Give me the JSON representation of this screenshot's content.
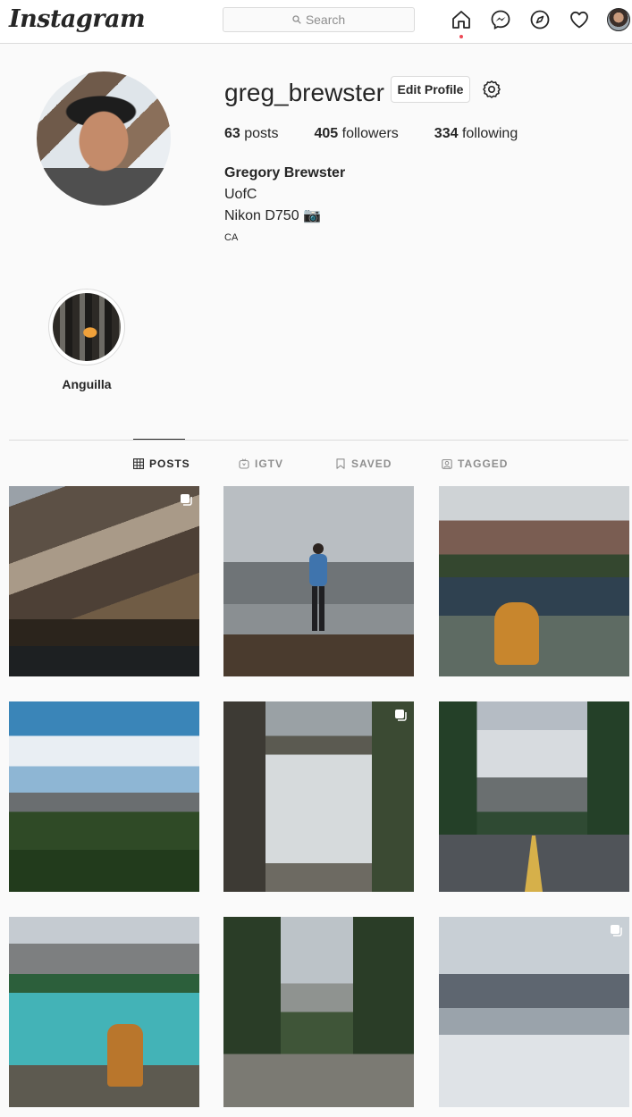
{
  "app": {
    "logo_text": "Instagram"
  },
  "search": {
    "placeholder": "Search"
  },
  "nav": {
    "icons": [
      "home-icon",
      "messenger-icon",
      "explore-icon",
      "activity-heart-icon",
      "profile-avatar"
    ]
  },
  "profile": {
    "username": "greg_brewster",
    "edit_label": "Edit Profile",
    "stats": {
      "posts_count": "63",
      "posts_label": "posts",
      "followers_count": "405",
      "followers_label": "followers",
      "following_count": "334",
      "following_label": "following"
    },
    "bio": {
      "full_name": "Gregory Brewster",
      "line1": "UofC",
      "line2": "Nikon D750 📷",
      "line3": "CA"
    }
  },
  "highlights": [
    {
      "label": "Anguilla"
    }
  ],
  "tabs": [
    {
      "label": "POSTS",
      "icon": "grid-icon",
      "active": true
    },
    {
      "label": "IGTV",
      "icon": "igtv-icon",
      "active": false
    },
    {
      "label": "SAVED",
      "icon": "bookmark-icon",
      "active": false
    },
    {
      "label": "TAGGED",
      "icon": "tagged-icon",
      "active": false
    }
  ],
  "posts": [
    {
      "subject": "mountain forest lake",
      "multi": true
    },
    {
      "subject": "hiker on ridge",
      "multi": false
    },
    {
      "subject": "boots by lake",
      "multi": false
    },
    {
      "subject": "green valley sky",
      "multi": false
    },
    {
      "subject": "waterfall",
      "multi": true
    },
    {
      "subject": "cyclist on road",
      "multi": false
    },
    {
      "subject": "turquoise lake",
      "multi": false
    },
    {
      "subject": "forest creek",
      "multi": false
    },
    {
      "subject": "snowy mountain",
      "multi": true
    }
  ],
  "colors": {
    "text": "#262626",
    "muted": "#8e8e8e",
    "border": "#dbdbdb",
    "notification": "#ed4956",
    "background": "#fafafa"
  }
}
